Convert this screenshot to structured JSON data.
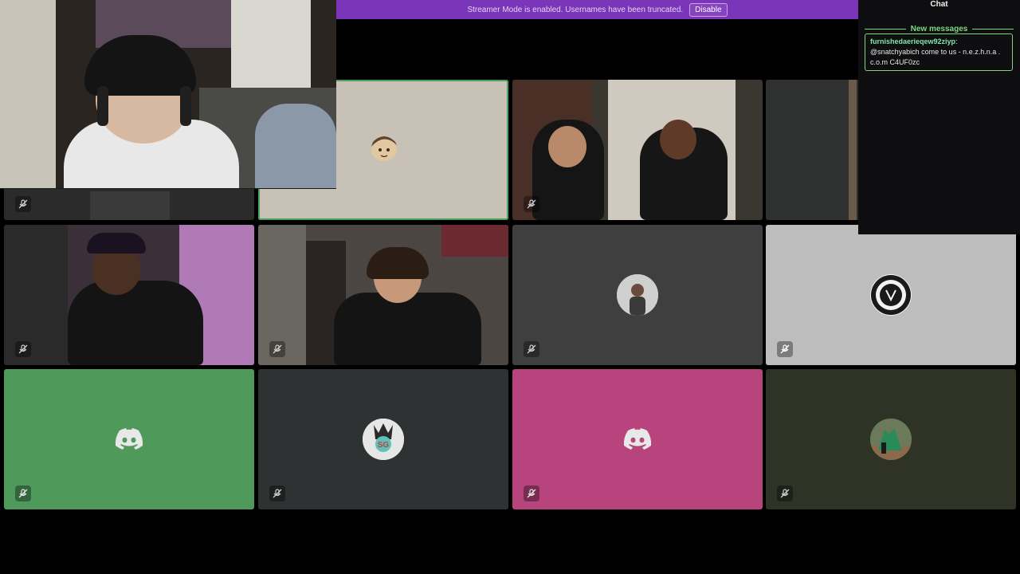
{
  "banner": {
    "message": "Streamer Mode is enabled. Usernames have been truncated.",
    "button_label": "Disable",
    "color": "#7b35b8"
  },
  "chat": {
    "title": "Chat",
    "new_messages_label": "New messages",
    "messages": [
      {
        "user": "furnishedaerieqew92ziyp",
        "separator": ":",
        "text": "@snatchyabich come to us - n.e.z.h.n.a . c.o.m C4UF0zc"
      }
    ],
    "accent_color": "#7dd87d"
  },
  "grid": {
    "tiles": [
      {
        "kind": "video",
        "name": "tile-1",
        "muted": true,
        "background": "#2b2b2b"
      },
      {
        "kind": "avatar",
        "name": "tile-2",
        "muted": false,
        "speaking": true,
        "background": "#c8c2b6",
        "icon": "anime-character-avatar"
      },
      {
        "kind": "video",
        "name": "tile-3",
        "muted": true,
        "background": "#3a3630"
      },
      {
        "kind": "video",
        "name": "tile-4",
        "muted": false,
        "background": "#2f3030"
      },
      {
        "kind": "video",
        "name": "tile-5",
        "muted": true,
        "background": "#3b2f3a"
      },
      {
        "kind": "video",
        "name": "tile-6",
        "muted": true,
        "background": "#4b4641"
      },
      {
        "kind": "avatar",
        "name": "tile-7",
        "muted": true,
        "background": "#3f3f3f",
        "icon": "person-photo-avatar"
      },
      {
        "kind": "avatar",
        "name": "tile-8",
        "muted": true,
        "background": "#bdbdbd",
        "icon": "emblem-avatar"
      },
      {
        "kind": "discord",
        "name": "tile-9",
        "muted": true,
        "background": "#4f9a5b",
        "icon": "discord-logo-icon"
      },
      {
        "kind": "avatar",
        "name": "tile-10",
        "muted": true,
        "background": "#2e3232",
        "icon": "character-avatar"
      },
      {
        "kind": "discord",
        "name": "tile-11",
        "muted": true,
        "background": "#b8447e",
        "icon": "discord-logo-icon"
      },
      {
        "kind": "avatar",
        "name": "tile-12",
        "muted": true,
        "background": "#2f3326",
        "icon": "outdoor-photo-avatar"
      }
    ]
  }
}
